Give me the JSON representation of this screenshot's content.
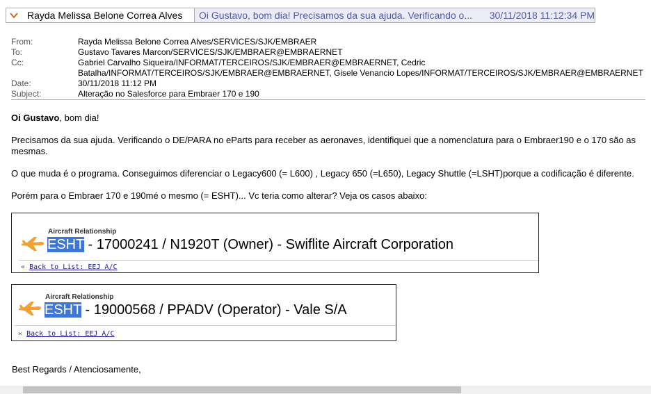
{
  "header": {
    "sender": "Rayda Melissa Belone Correa Alves",
    "preview": "Oi Gustavo, bom dia! Precisamos da sua ajuda. Verificando o...",
    "datetime": "30/11/2018 11:12:34 PM"
  },
  "meta": {
    "from_label": "From:",
    "from": "Rayda Melissa Belone Correa Alves/SERVICES/SJK/EMBRAER",
    "to_label": "To:",
    "to": "Gustavo Tavares Marcon/SERVICES/SJK/EMBRAER@EMBRAERNET",
    "cc_label": "Cc:",
    "cc_line1": "Gabriel Carvalho Siqueira/INFORMAT/TERCEIROS/SJK/EMBRAER@EMBRAERNET, Cedric",
    "cc_line2": "Batalha/INFORMAT/TERCEIROS/SJK/EMBRAER@EMBRAERNET, Gisele Venancio Lopes/INFORMAT/TERCEIROS/SJK/EMBRAER@EMBRAERNET",
    "date_label": "Date:",
    "date": "30/11/2018 11:12 PM",
    "subject_label": "Subject:",
    "subject": "Alteração no Salesforce para Embraer 170 e 190"
  },
  "body": {
    "greeting_bold": "Oi Gustavo",
    "greeting_rest": ", bom dia!",
    "p2": "Precisamos da sua ajuda. Verificando o DE/PARA no eParts para receber as aeronaves, identifiquei que a nomenclatura para o Embraer190 e o 170 são as mesmas.",
    "p3": "O que muda é o programa. Conseguimos diferenciar o Legacy600 (= L600) , Legacy 650 (=L650), Legacy Shuttle (=LSHT)porque a codificação é diferente.",
    "p4": "Porém para o Embraer 170 e 190mé o mesmo (= ESHT)... Vc teria como alterar? Veja os casos abaixo:",
    "closing": "Best Regards / Atenciosamente,"
  },
  "records": [
    {
      "label": "Aircraft Relationship",
      "code": "ESHT",
      "rest": " - 17000241 / N1920T (Owner) - Swiflite Aircraft Corporation",
      "back_prefix": "«",
      "back": "Back to List: EEJ A/C"
    },
    {
      "label": "Aircraft Relationship",
      "code": "ESHT",
      "rest": " - 19000568 / PPADV (Operator) - Vale S/A",
      "back_prefix": "«",
      "back": "Back to List: EEJ A/C"
    }
  ],
  "colors": {
    "preview_bg": "#ececf7",
    "preview_text": "#4f5aa8",
    "chevron": "#d9641e",
    "highlight": "#3d76d6",
    "plane": "#f0a035"
  }
}
